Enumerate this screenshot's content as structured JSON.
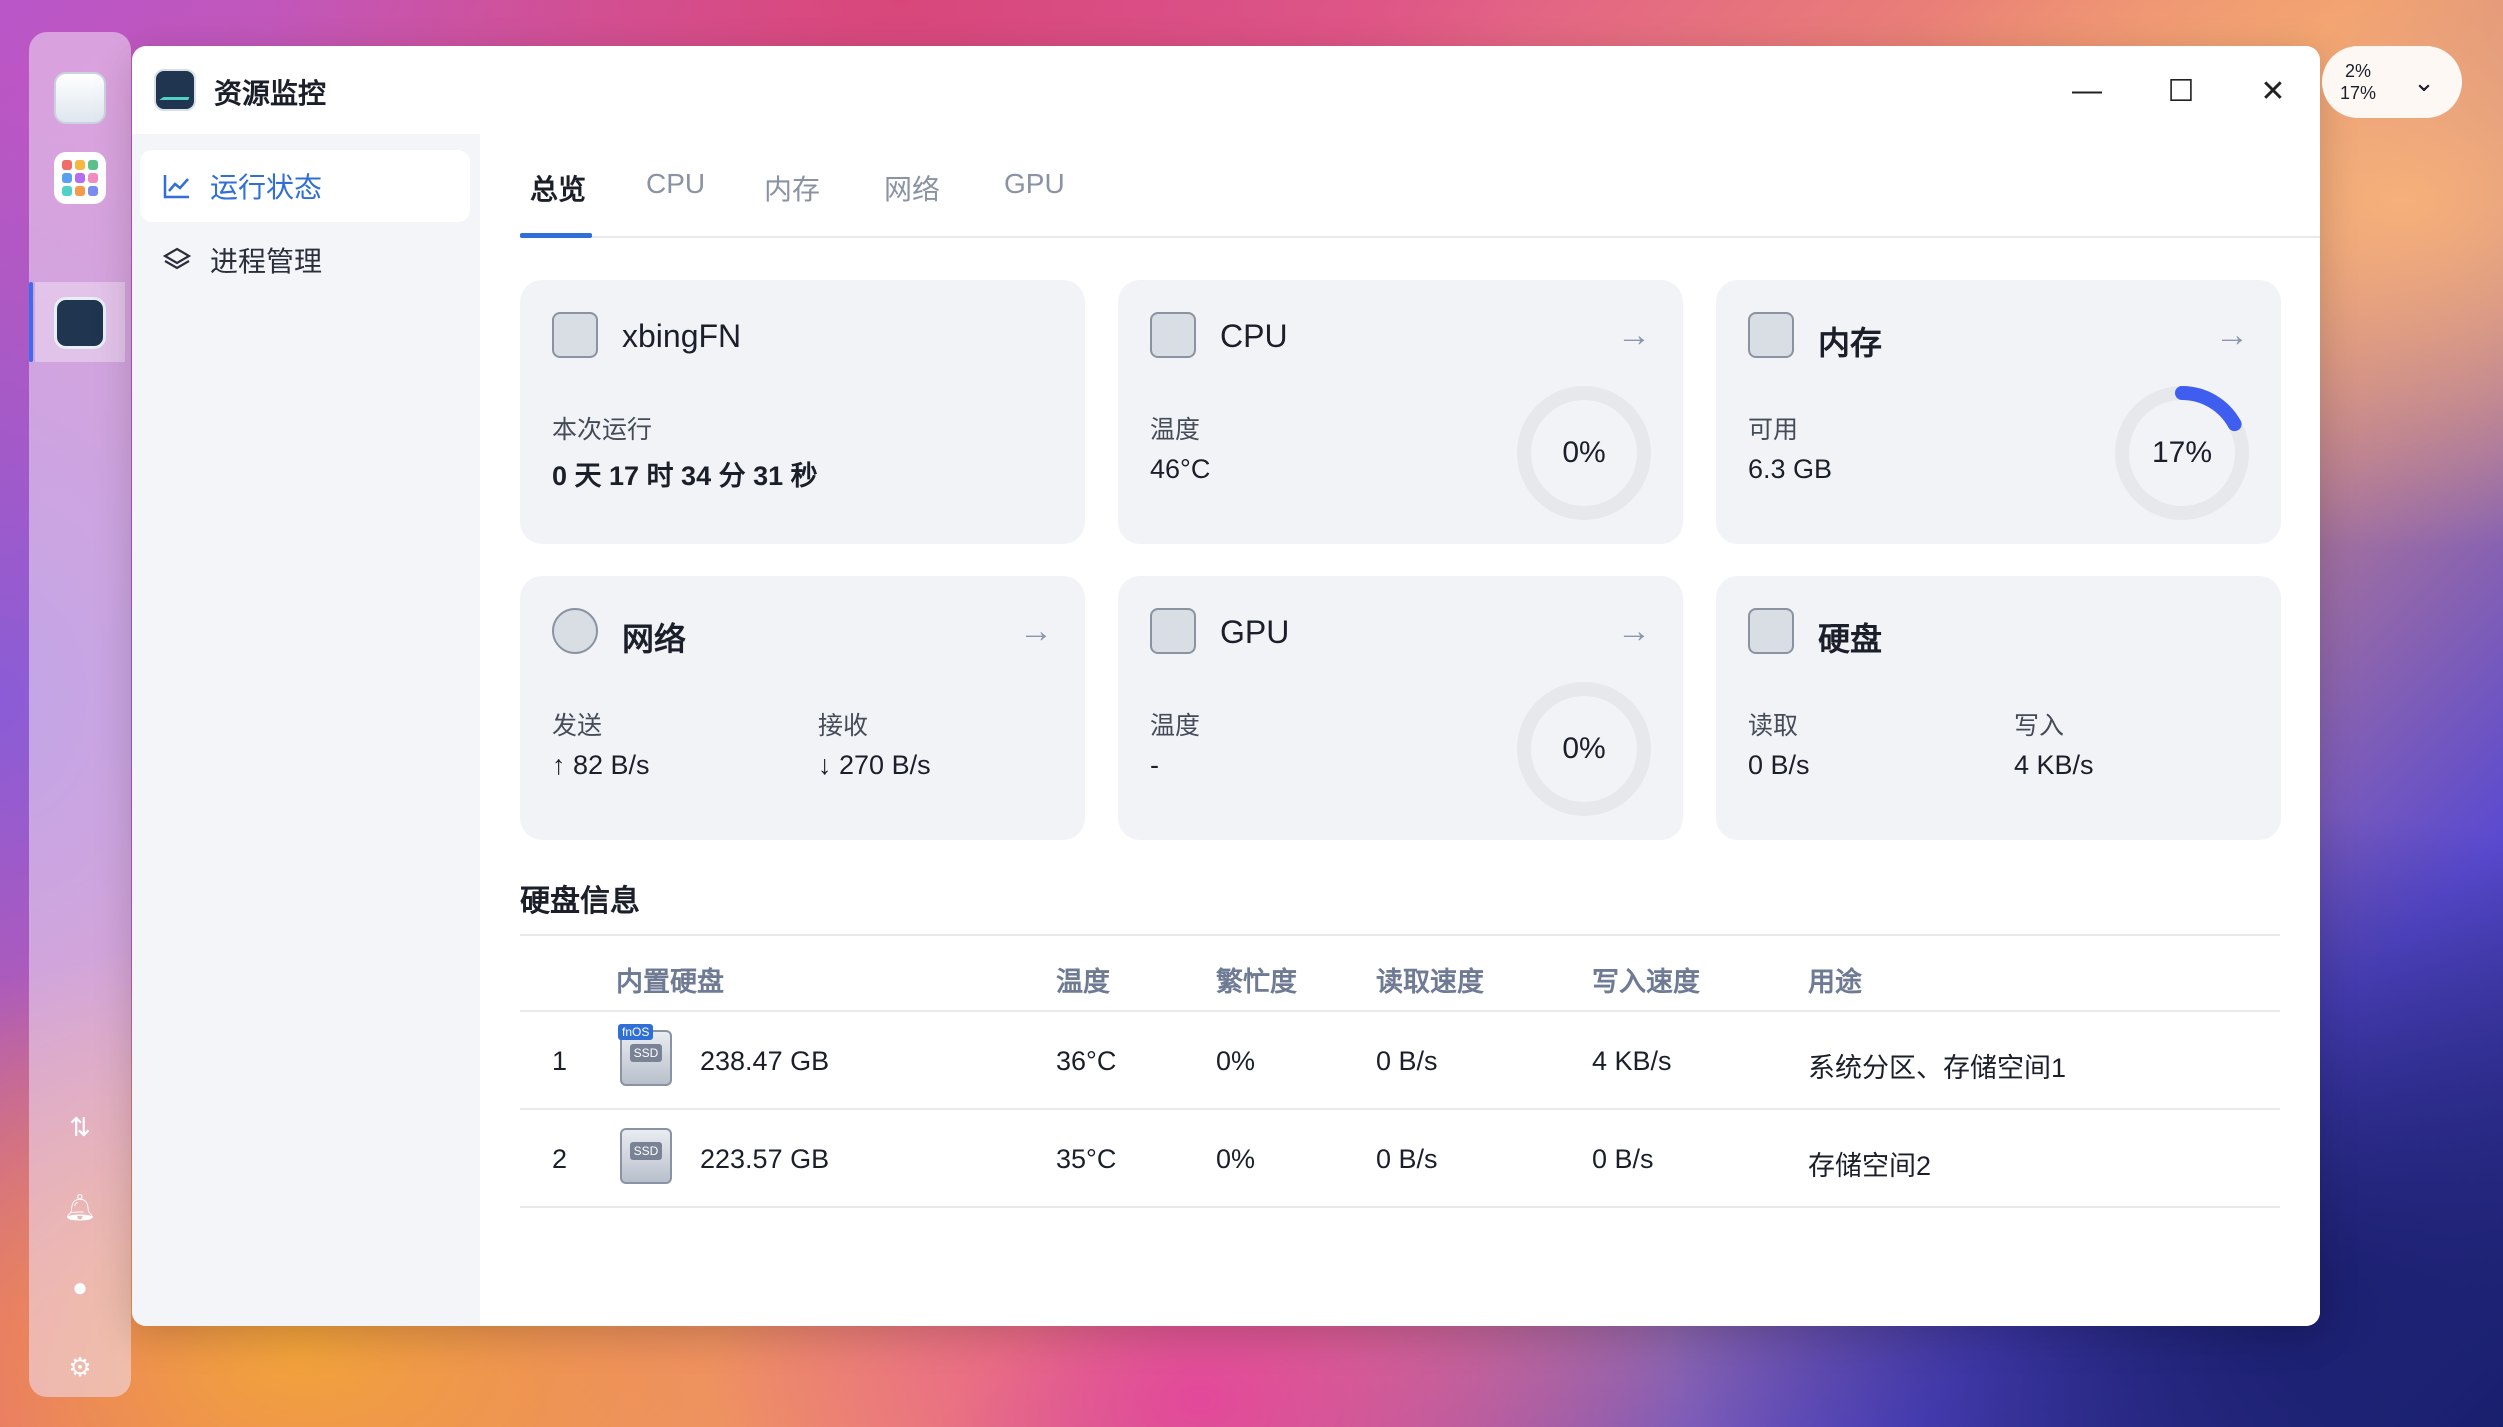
{
  "app": {
    "title": "资源监控"
  },
  "sidebar": {
    "items": [
      {
        "label": "运行状态",
        "icon": "line-chart-icon",
        "active": true
      },
      {
        "label": "进程管理",
        "icon": "layers-icon",
        "active": false
      }
    ]
  },
  "tabs": [
    {
      "label": "总览",
      "active": true
    },
    {
      "label": "CPU",
      "active": false
    },
    {
      "label": "内存",
      "active": false
    },
    {
      "label": "网络",
      "active": false
    },
    {
      "label": "GPU",
      "active": false
    }
  ],
  "cards": {
    "system": {
      "title": "xbingFN",
      "uptime_label": "本次运行",
      "uptime_value": "0 天 17 时 34 分 31 秒"
    },
    "cpu": {
      "title": "CPU",
      "temp_label": "温度",
      "temp_value": "46°C",
      "usage": "0%",
      "usage_fraction": 0
    },
    "memory": {
      "title": "内存",
      "avail_label": "可用",
      "avail_value": "6.3 GB",
      "usage": "17%",
      "usage_fraction": 0.17
    },
    "network": {
      "title": "网络",
      "send_label": "发送",
      "send_value": "82 B/s",
      "recv_label": "接收",
      "recv_value": "270 B/s"
    },
    "gpu": {
      "title": "GPU",
      "temp_label": "温度",
      "temp_value": "-",
      "usage": "0%",
      "usage_fraction": 0
    },
    "disk": {
      "title": "硬盘",
      "read_label": "读取",
      "read_value": "0 B/s",
      "write_label": "写入",
      "write_value": "4 KB/s"
    }
  },
  "disk_info": {
    "title": "硬盘信息",
    "headers": [
      "内置硬盘",
      "温度",
      "繁忙度",
      "读取速度",
      "写入速度",
      "用途"
    ],
    "rows": [
      {
        "index": "1",
        "size": "238.47 GB",
        "temp": "36°C",
        "busy": "0%",
        "read": "0 B/s",
        "write": "4 KB/s",
        "usage": "系统分区、存储空间1",
        "badge": "fnOS",
        "icon_label": "SSD"
      },
      {
        "index": "2",
        "size": "223.57 GB",
        "temp": "35°C",
        "busy": "0%",
        "read": "0 B/s",
        "write": "0 B/s",
        "usage": "存储空间2",
        "icon_label": "SSD"
      }
    ]
  },
  "tray": {
    "cpu": "2%",
    "mem": "17%"
  },
  "colors": {
    "accent": "#2f6fd6",
    "ring_track": "#e6e8ec",
    "ring_fill": "#3f5ef0"
  }
}
